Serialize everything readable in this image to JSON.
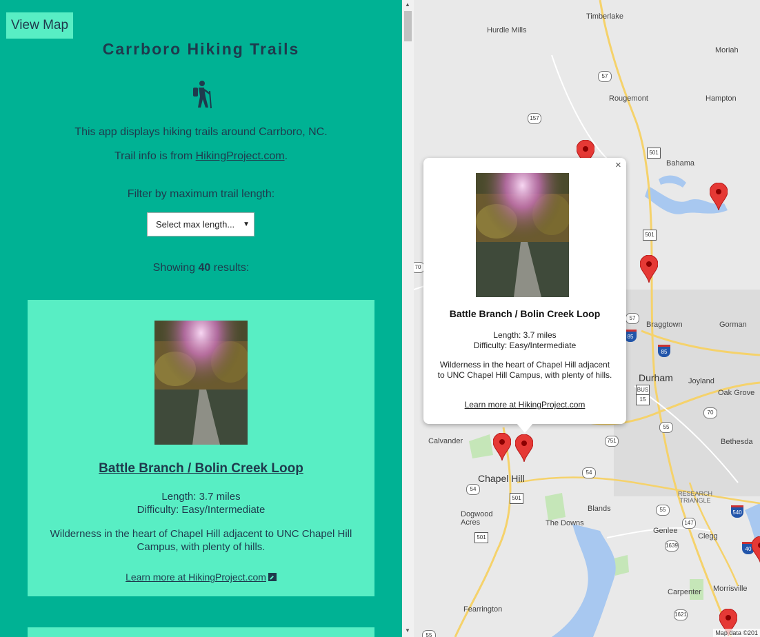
{
  "sidebar": {
    "view_map_label": "View Map",
    "title": "Carrboro Hiking Trails",
    "icon": "hiker-icon",
    "intro_line1": "This app displays hiking trails around Carrboro, NC.",
    "intro_line2_prefix": "Trail info is from ",
    "intro_link": "HikingProject.com",
    "intro_line2_suffix": ".",
    "filter_label": "Filter by maximum trail length:",
    "filter_select_value": "Select max length...",
    "results_prefix": "Showing ",
    "results_count": "40",
    "results_suffix": " results:"
  },
  "trails": [
    {
      "name": "Battle Branch / Bolin Creek Loop",
      "length": "Length: 3.7 miles",
      "difficulty": "Difficulty: Easy/Intermediate",
      "description": "Wilderness in the heart of Chapel Hill adjacent to UNC Chapel Hill Campus, with plenty of hills.",
      "link": "Learn more at HikingProject.com"
    }
  ],
  "popup": {
    "name": "Battle Branch / Bolin Creek Loop",
    "length": "Length: 3.7 miles",
    "difficulty": "Difficulty: Easy/Intermediate",
    "description": "Wilderness in the heart of Chapel Hill adjacent to UNC Chapel Hill Campus, with plenty of hills.",
    "link": "Learn more at HikingProject.com",
    "close": "×"
  },
  "map": {
    "places": {
      "timberlake": "Timberlake",
      "hurdle_mills": "Hurdle Mills",
      "moriah": "Moriah",
      "rougemont": "Rougemont",
      "hampton": "Hampton",
      "bahama": "Bahama",
      "braggtown": "Braggtown",
      "gorman": "Gorman",
      "durham": "Durham",
      "joyland": "Joyland",
      "oak_grove": "Oak Grove",
      "bethesda": "Bethesda",
      "calvander": "Calvander",
      "chapel_hill": "Chapel Hill",
      "research_triangle": "RESEARCH TRIANGLE",
      "dogwood_acres": "Dogwood Acres",
      "blands": "Blands",
      "the_downs": "The Downs",
      "genlee": "Genlee",
      "clegg": "Clegg",
      "carpenter": "Carpenter",
      "morrisville": "Morrisville",
      "fearrington": "Fearrington"
    },
    "routes": {
      "r57a": "57",
      "r157": "157",
      "r501a": "501",
      "r501b": "501",
      "r57b": "57",
      "r85a": "85",
      "r85b": "85",
      "bus": "BUS",
      "r15": "15",
      "r70a": "70",
      "r70b": "70",
      "r751": "751",
      "r55a": "55",
      "r54a": "54",
      "r54b": "54",
      "r501c": "501",
      "r501d": "501",
      "r55b": "55",
      "r147": "147",
      "r1639": "1639",
      "r540": "540",
      "r40": "40",
      "r1621": "1621",
      "r55c": "55"
    },
    "attribution": "Map data ©201"
  },
  "colors": {
    "sidebar_bg": "#00b294",
    "card_bg": "#58eec4",
    "text": "#1f3a4d",
    "pin": "#e53935"
  }
}
